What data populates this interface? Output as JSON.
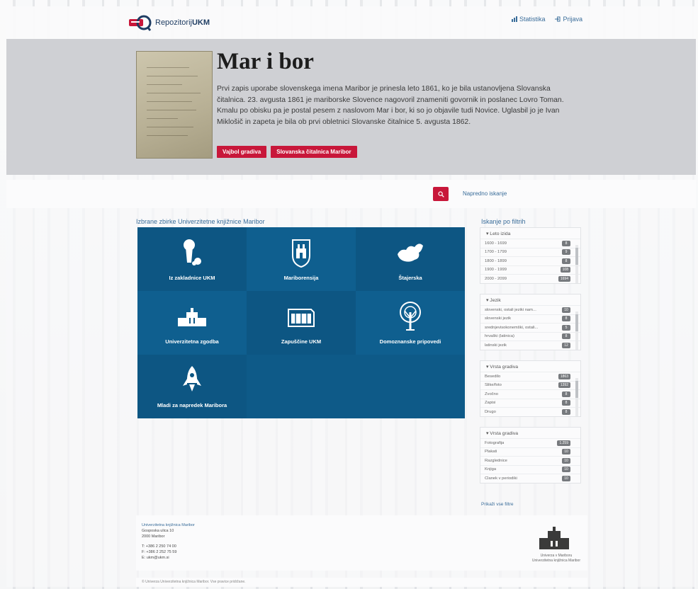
{
  "header": {
    "logo_text_light": "Repozitorij",
    "logo_text_bold": "UKM",
    "links": [
      {
        "label": "Statistika",
        "icon": "chart-icon"
      },
      {
        "label": "Prijava",
        "icon": "login-icon"
      }
    ]
  },
  "hero": {
    "title": "Mar i bor",
    "text": "Prvi zapis uporabe slovenskega imena Maribor je prinesla leto 1861, ko je bila ustanovljena Slovanska čitalnica. 23. avgusta 1861 je mariborske Slovence nagovoril znameniti govornik in poslanec Lovro Toman. Kmalu po obisku pa je postal pesem z naslovom Mar i bor, ki so jo objavile tudi Novice. Uglasbil jo je Ivan Miklošič in zapeta je bila ob prvi obletnici Slovanske čitalnice 5. avgusta 1862.",
    "buttons": [
      "Vajbol gradiva",
      "Slovanska čitalnica Maribor"
    ]
  },
  "search": {
    "button_icon": "search-icon",
    "advanced_label": "Napredno iskanje"
  },
  "collections": {
    "title": "Izbrane zbirke Univerzitetne knjižnice Maribor",
    "tiles": [
      {
        "label": "Iz zakladnice UKM",
        "icon": "keyhole-icon"
      },
      {
        "label": "Mariborensija",
        "icon": "coat-of-arms-icon"
      },
      {
        "label": "Štajerska",
        "icon": "region-map-icon"
      },
      {
        "label": "Univerzitetna zgodba",
        "icon": "building-icon"
      },
      {
        "label": "Zapuščine UKM",
        "icon": "archive-box-icon"
      },
      {
        "label": "Domoznanske pripovedi",
        "icon": "tree-icon"
      },
      {
        "label": "Mladi za napredek Maribora",
        "icon": "rocket-icon"
      }
    ]
  },
  "filters": {
    "title": "Iskanje po filtrih",
    "groups": [
      {
        "heading": "▾ Leto izida",
        "items": [
          {
            "label": "1600 - 1699",
            "count": "8"
          },
          {
            "label": "1700 - 1799",
            "count": "9"
          },
          {
            "label": "1800 - 1899",
            "count": "8"
          },
          {
            "label": "1900 - 1999",
            "count": "108"
          },
          {
            "label": "2000 - 2099",
            "count": "1694"
          }
        ]
      },
      {
        "heading": "▾ Jezik",
        "items": [
          {
            "label": "slovenski, ostali jeziki nam...",
            "count": "10"
          },
          {
            "label": "slovenski jezik",
            "count": "8"
          },
          {
            "label": "srednjevisokonemški, ostali...",
            "count": "5"
          },
          {
            "label": "hrvaški (latinica)",
            "count": "8"
          },
          {
            "label": "latinski jezik",
            "count": "12"
          }
        ]
      },
      {
        "heading": "▾ Vrsta gradiva",
        "items": [
          {
            "label": "Besedilo",
            "count": "1863"
          },
          {
            "label": "Slike/foto",
            "count": "1392"
          },
          {
            "label": "Zvočno",
            "count": "8"
          },
          {
            "label": "Zapisi",
            "count": "8"
          },
          {
            "label": "Drugo",
            "count": "8"
          }
        ]
      },
      {
        "heading": "▾ Vrsta gradiva",
        "items": [
          {
            "label": "Fotografija",
            "count": "1.259"
          },
          {
            "label": "Plakati",
            "count": "10"
          },
          {
            "label": "Razglednice",
            "count": "10"
          },
          {
            "label": "Knjiga",
            "count": "10"
          },
          {
            "label": "Članek v periodiki",
            "count": "10"
          }
        ]
      }
    ],
    "more_label": "Prikaži vse filtre"
  },
  "footer": {
    "org_name": "Univerzitetna knjižnica Maribor",
    "address_line1": "Gosposka ulica 10",
    "address_line2": "2000 Maribor",
    "phone": "T: +386 2 250 74 00",
    "fax": "F: +386 2 252 75 59",
    "email": "E: ukm@ukm.si",
    "seal_line1": "Univerza v Mariboru",
    "seal_line2": "Univerzitetna knjižnica Maribor",
    "copyright": "© Univerza Univerzitetna knjižnica Maribor. Vse pravice pridržane."
  },
  "colors": {
    "accent_red": "#c8173a",
    "tile_blue": "#0e5a88",
    "link_blue": "#3a6d9a"
  }
}
